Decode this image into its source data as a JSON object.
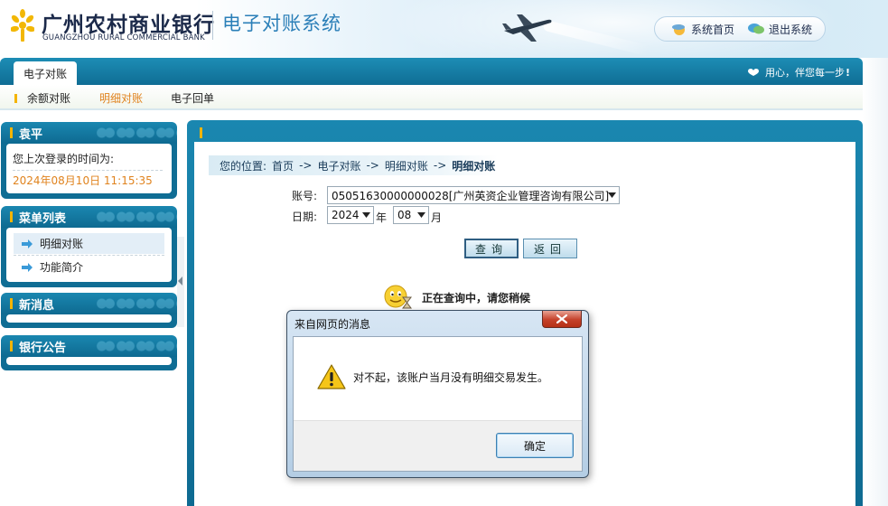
{
  "header": {
    "bank_name_cn": "广州农村商业银行",
    "bank_name_en": "GUANGZHOU RURAL COMMERCIAL BANK",
    "system_title": "电子对账系统",
    "links": [
      {
        "label": "系统首页",
        "icon": "home-icon"
      },
      {
        "label": "退出系统",
        "icon": "chat-bubble-icon"
      }
    ]
  },
  "nav": {
    "active_tab": "电子对账",
    "slogan": "用心，伴您每一步",
    "sub_items": [
      {
        "label": "余额对账",
        "active": false
      },
      {
        "label": "明细对账",
        "active": true
      },
      {
        "label": "电子回单",
        "active": false
      }
    ]
  },
  "sidebar": {
    "user_panel": {
      "title": "袁平",
      "login_label": "您上次登录的时间为:",
      "login_time": "2024年08月10日  11:15:35"
    },
    "menu_panel": {
      "title": "菜单列表",
      "items": [
        {
          "label": "明细对账",
          "icon": "arrow-right-icon",
          "selected": true
        },
        {
          "label": "功能简介",
          "icon": "arrow-right-icon",
          "selected": false
        }
      ]
    },
    "news_panel": {
      "title": "新消息"
    },
    "notice_panel": {
      "title": "银行公告"
    }
  },
  "main": {
    "breadcrumb": {
      "prefix": "您的位置:",
      "items": [
        "首页",
        "电子对账",
        "明细对账"
      ],
      "current": "明细对账",
      "separator": "->"
    },
    "account_label": "账号:",
    "account_value": "05051630000000028[广州英资企业管理咨询有限公司]",
    "date_label": "日期:",
    "year_value": "2024",
    "year_unit": "年",
    "month_value": "08",
    "month_unit": "月",
    "query_button": "查询",
    "back_button": "返回",
    "querying_text": "正在查询中，请您稍候"
  },
  "dialog": {
    "title": "来自网页的消息",
    "message": "对不起，该账户当月没有明细交易发生。",
    "ok_label": "确定"
  },
  "colors": {
    "nav_blue": "#0f6d94",
    "accent_orange": "#e0831e",
    "marker_yellow": "#f4b400",
    "title_blue": "#2b7fb8"
  }
}
